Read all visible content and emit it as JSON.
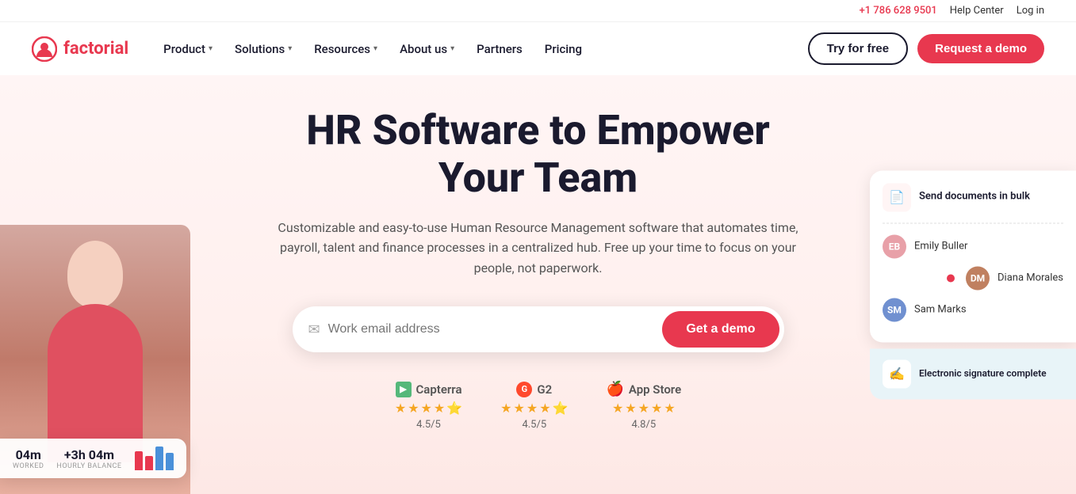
{
  "topbar": {
    "phone": "+1 786 628 9501",
    "help_center": "Help Center",
    "login": "Log in"
  },
  "nav": {
    "logo_text": "factorial",
    "items": [
      {
        "label": "Product",
        "has_dropdown": true
      },
      {
        "label": "Solutions",
        "has_dropdown": true
      },
      {
        "label": "Resources",
        "has_dropdown": true
      },
      {
        "label": "About us",
        "has_dropdown": true
      },
      {
        "label": "Partners",
        "has_dropdown": false
      },
      {
        "label": "Pricing",
        "has_dropdown": false
      }
    ],
    "try_free": "Try for free",
    "request_demo": "Request a demo"
  },
  "hero": {
    "title": "HR Software to Empower Your Team",
    "description": "Customizable and easy-to-use Human Resource Management software that automates time, payroll, talent and finance processes in a centralized hub. Free up your time to focus on your people, not paperwork.",
    "email_placeholder": "Work email address",
    "cta_button": "Get a demo"
  },
  "ratings": [
    {
      "brand": "Capterra",
      "icon_type": "capterra",
      "stars": 4.5,
      "score": "4.5/5"
    },
    {
      "brand": "G2",
      "icon_type": "g2",
      "stars": 4.5,
      "score": "4.5/5"
    },
    {
      "brand": "App Store",
      "icon_type": "apple",
      "stars": 4.8,
      "score": "4.8/5"
    }
  ],
  "widget_time": {
    "worked_value": "04m",
    "worked_label": "WORKED",
    "balance_value": "+3h 04m",
    "balance_label": "HOURLY BALANCE"
  },
  "right_widget": {
    "doc_title": "Send documents in bulk",
    "doc_icon": "📄",
    "people": [
      {
        "name": "Emily Buller",
        "initials": "EB",
        "color": "pink"
      },
      {
        "name": "Diana Morales",
        "initials": "DM",
        "color": "brown"
      },
      {
        "name": "Sam Marks",
        "initials": "SM",
        "color": "blue"
      }
    ],
    "signature_text": "Electronic signature complete",
    "signature_icon": "✍️"
  },
  "colors": {
    "brand_red": "#e8384f",
    "nav_dark": "#1a1a2e"
  }
}
